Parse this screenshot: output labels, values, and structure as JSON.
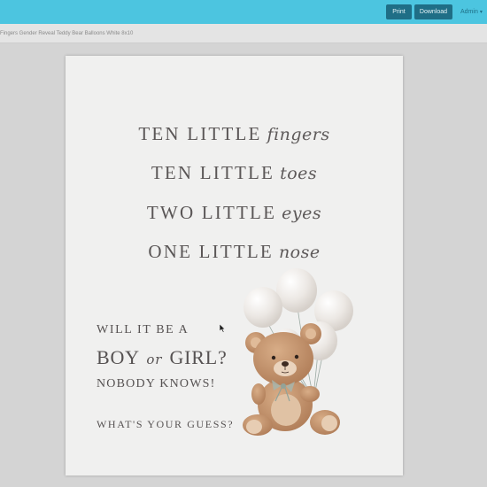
{
  "toolbar": {
    "print_label": "Print",
    "download_label": "Download",
    "user_label": "Admin",
    "user_chevron_icon": "chevron-down-icon"
  },
  "breadcrumb": {
    "text": "e Fingers Gender Reveal Teddy Bear Balloons White 8x10"
  },
  "document": {
    "verses": [
      {
        "caps": "TEN LITTLE",
        "script": "fingers"
      },
      {
        "caps": "TEN LITTLE",
        "script": "toes"
      },
      {
        "caps": "TWO LITTLE",
        "script": "eyes"
      },
      {
        "caps": "ONE LITTLE",
        "script": "nose"
      }
    ],
    "question": {
      "line1": "WILL IT BE A",
      "boy": "BOY",
      "or": "or",
      "girl": "GIRL?",
      "line3": "NOBODY KNOWS!",
      "line4": "WHAT'S YOUR GUESS?"
    },
    "artwork": "teddy-bear-with-balloons-illustration"
  },
  "colors": {
    "topbar": "#4cc5e0",
    "button": "#1f6e86",
    "page_text": "#5a5656",
    "canvas": "#d4d4d4"
  }
}
